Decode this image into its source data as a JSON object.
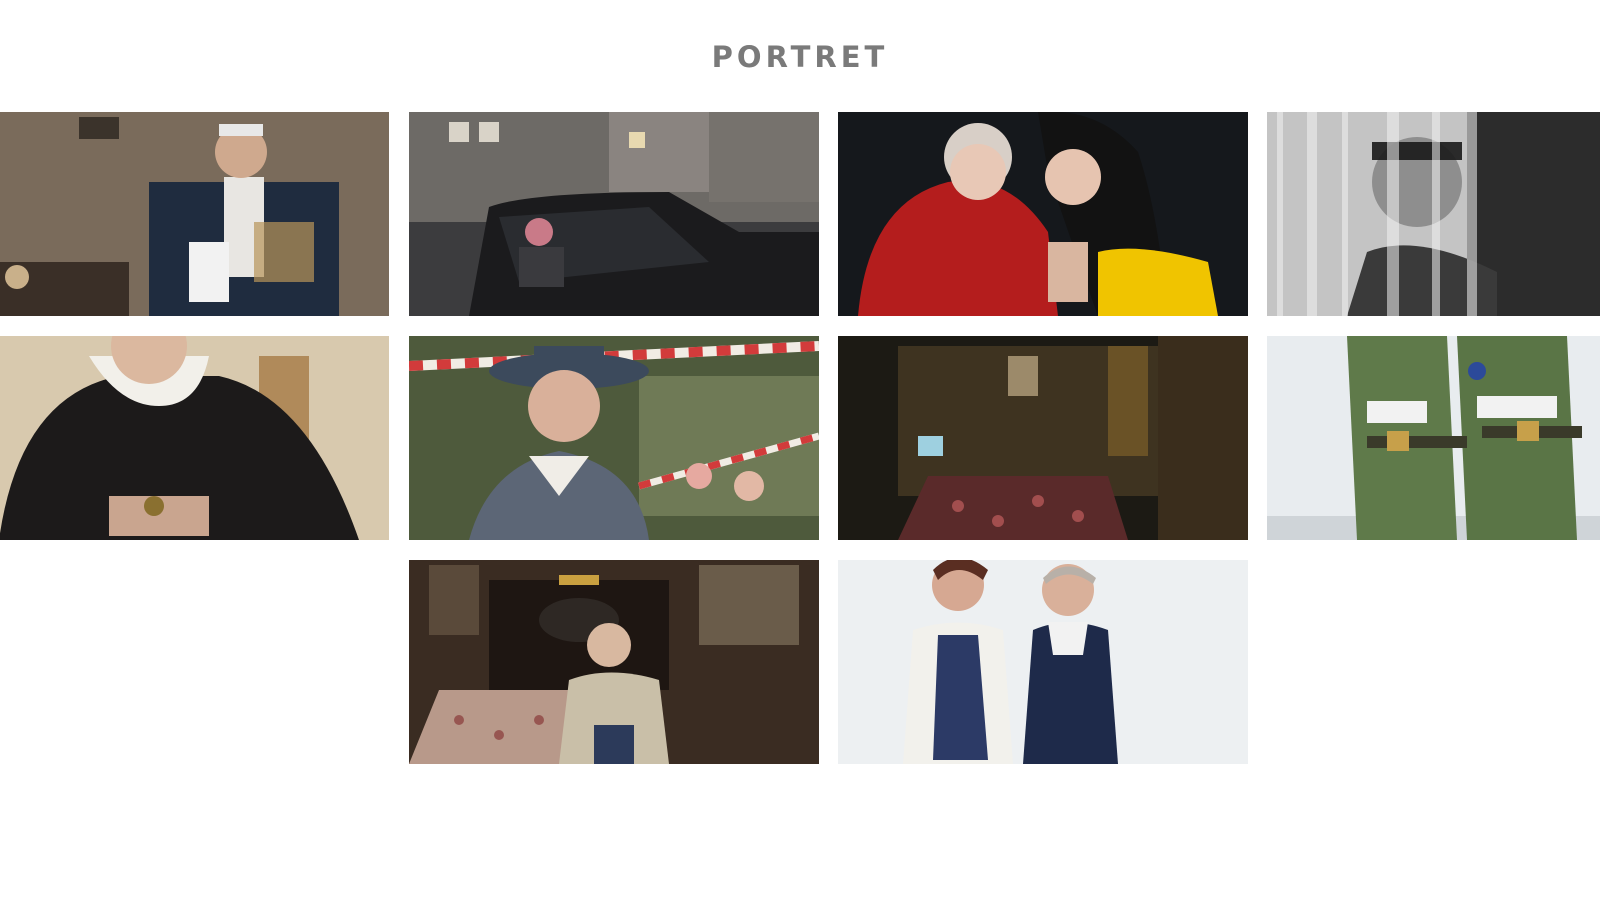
{
  "section": {
    "title": "PORTRET"
  },
  "colors": {
    "title": "#7a7a7a",
    "background": "#ffffff"
  },
  "photos": [
    {
      "subject": "veteran-in-uniform"
    },
    {
      "subject": "woman-in-parked-car-at-night"
    },
    {
      "subject": "elderly-woman-and-young-woman"
    },
    {
      "subject": "man-with-glasses-behind-curtain"
    },
    {
      "subject": "nun-with-rosary"
    },
    {
      "subject": "woman-in-hat-smoking"
    },
    {
      "subject": "dark-room-interior"
    },
    {
      "subject": "two-figures-in-camouflage"
    },
    {
      "subject": "elderly-man-at-table"
    },
    {
      "subject": "two-elderly-women-standing"
    }
  ]
}
